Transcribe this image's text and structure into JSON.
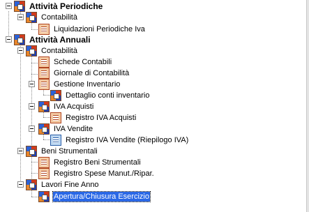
{
  "tree": {
    "nodes": [
      {
        "label": "Attività Periodiche",
        "icon": "folder-icon"
      },
      {
        "label": "Contabilità",
        "icon": "folder-icon"
      },
      {
        "label": "Liquidazioni Periodiche Iva",
        "icon": "report-icon"
      },
      {
        "label": "Attività Annuali",
        "icon": "folder-icon"
      },
      {
        "label": "Contabilità",
        "icon": "folder-icon"
      },
      {
        "label": "Schede Contabili",
        "icon": "report-icon"
      },
      {
        "label": "Giornale di Contabilità",
        "icon": "report-icon"
      },
      {
        "label": "Gestione Inventario",
        "icon": "report-icon"
      },
      {
        "label": "Dettaglio conti inventario",
        "icon": "folder-icon"
      },
      {
        "label": "IVA Acquisti",
        "icon": "folder-icon"
      },
      {
        "label": "Registro IVA Acquisti",
        "icon": "report-icon"
      },
      {
        "label": "IVA Vendite",
        "icon": "folder-icon"
      },
      {
        "label": "Registro IVA Vendite (Riepilogo IVA)",
        "icon": "report-blue-icon"
      },
      {
        "label": "Beni Strumentali",
        "icon": "folder-icon"
      },
      {
        "label": "Registro Beni Strumentali",
        "icon": "report-icon"
      },
      {
        "label": "Registro Spese Manut./Ripar.",
        "icon": "report-icon"
      },
      {
        "label": "Lavori Fine Anno",
        "icon": "folder-icon"
      },
      {
        "label": "Apertura/Chiusura Esercizio",
        "icon": "folder-icon",
        "selected": true
      }
    ]
  },
  "colors": {
    "selection": "#2a68e6"
  }
}
